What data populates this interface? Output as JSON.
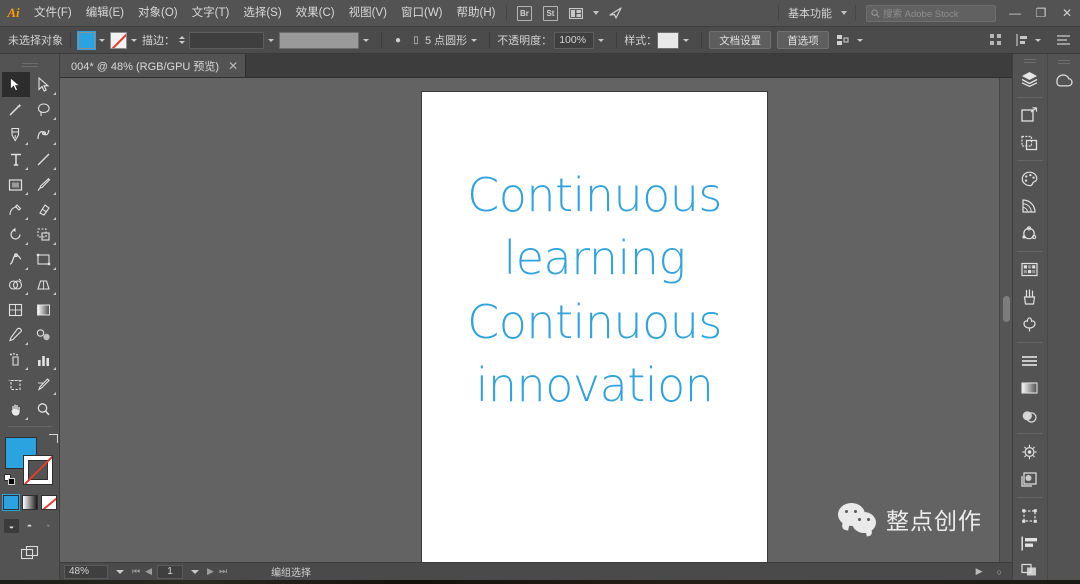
{
  "app": {
    "name": "Adobe Illustrator",
    "logo_text": "Ai",
    "accent_blue": "#2ba3e0",
    "chrome_bg": "#535353",
    "canvas_bg": "#636363"
  },
  "menubar": {
    "items": [
      {
        "label": "文件(F)"
      },
      {
        "label": "编辑(E)"
      },
      {
        "label": "对象(O)"
      },
      {
        "label": "文字(T)"
      },
      {
        "label": "选择(S)"
      },
      {
        "label": "效果(C)"
      },
      {
        "label": "视图(V)"
      },
      {
        "label": "窗口(W)"
      },
      {
        "label": "帮助(H)"
      }
    ],
    "icons": [
      {
        "name": "bridge-icon",
        "glyph": "Br"
      },
      {
        "name": "stock-icon",
        "glyph": "St"
      },
      {
        "name": "arrange-documents-icon",
        "glyph": "▤"
      },
      {
        "name": "mobile-preview-icon",
        "glyph": "✈"
      }
    ],
    "workspace": "基本功能",
    "search_placeholder": "搜索 Adobe Stock",
    "window_buttons": [
      "—",
      "❐",
      "✕"
    ]
  },
  "controlbar": {
    "selection_state": "未选择对象",
    "fill_label": "填色",
    "fill_color": "#2ba3e0",
    "stroke_label": "描边：",
    "stroke_value": "",
    "stroke_weight": "",
    "brush_label": "",
    "variable_width_label": "5 点圆形",
    "opacity_label": "不透明度：",
    "opacity_value": "100%",
    "style_label": "样式：",
    "doc_setup_button": "文档设置",
    "preferences_button": "首选项",
    "align_icon": "align-icon",
    "distribute_icon": "distribute-icon",
    "transform_icon": "transform-icon",
    "menu_icon": "panel-menu-icon"
  },
  "tabs": [
    {
      "title": "004* @ 48% (RGB/GPU 预览)",
      "close": "✕",
      "active": true
    }
  ],
  "toolbar": {
    "tools": [
      {
        "name": "selection-tool",
        "label": "选择工具",
        "active": true
      },
      {
        "name": "direct-selection-tool",
        "label": "直接选择工具",
        "active": false
      },
      {
        "name": "magic-wand-tool",
        "label": "魔棒工具",
        "active": false
      },
      {
        "name": "lasso-tool",
        "label": "套索工具",
        "active": false
      },
      {
        "name": "pen-tool",
        "label": "钢笔工具",
        "active": false
      },
      {
        "name": "curvature-tool",
        "label": "曲率工具",
        "active": false
      },
      {
        "name": "type-tool",
        "label": "文字工具",
        "active": false
      },
      {
        "name": "line-segment-tool",
        "label": "直线段工具",
        "active": false
      },
      {
        "name": "rectangle-tool",
        "label": "矩形工具",
        "active": false
      },
      {
        "name": "paintbrush-tool",
        "label": "画笔工具",
        "active": false
      },
      {
        "name": "pencil-tool",
        "label": "铅笔工具",
        "active": false
      },
      {
        "name": "eraser-tool",
        "label": "橡皮擦工具",
        "active": false
      },
      {
        "name": "rotate-tool",
        "label": "旋转工具",
        "active": false
      },
      {
        "name": "scale-tool",
        "label": "比例缩放工具",
        "active": false
      },
      {
        "name": "width-tool",
        "label": "宽度工具",
        "active": false
      },
      {
        "name": "free-transform-tool",
        "label": "自由变换工具",
        "active": false
      },
      {
        "name": "shape-builder-tool",
        "label": "形状生成器工具",
        "active": false
      },
      {
        "name": "perspective-grid-tool",
        "label": "透视网格工具",
        "active": false
      },
      {
        "name": "mesh-tool",
        "label": "网格工具",
        "active": false
      },
      {
        "name": "gradient-tool",
        "label": "渐变工具",
        "active": false
      },
      {
        "name": "eyedropper-tool",
        "label": "吸管工具",
        "active": false
      },
      {
        "name": "blend-tool",
        "label": "混合工具",
        "active": false
      },
      {
        "name": "symbol-sprayer-tool",
        "label": "符号喷枪工具",
        "active": false
      },
      {
        "name": "column-graph-tool",
        "label": "柱形图工具",
        "active": false
      },
      {
        "name": "artboard-tool",
        "label": "画板工具",
        "active": false
      },
      {
        "name": "slice-tool",
        "label": "切片工具",
        "active": false
      },
      {
        "name": "hand-tool",
        "label": "抓手工具",
        "active": false
      },
      {
        "name": "zoom-tool",
        "label": "缩放工具",
        "active": false
      }
    ],
    "fill_color": "#2ba3e0",
    "stroke_color": "none",
    "color_modes": [
      {
        "name": "color-mode-solid",
        "selected": true
      },
      {
        "name": "color-mode-gradient",
        "selected": false
      },
      {
        "name": "color-mode-none",
        "selected": false
      }
    ],
    "draw_modes": [
      {
        "name": "draw-normal-mode",
        "glyph": "◒",
        "selected": true
      },
      {
        "name": "draw-behind-mode",
        "glyph": "◓",
        "selected": false
      },
      {
        "name": "draw-inside-mode",
        "glyph": "◔",
        "selected": false
      }
    ],
    "screen_mode": {
      "name": "change-screen-mode",
      "glyph": "❐"
    }
  },
  "canvas": {
    "artboard_lines": [
      "Continuous",
      "learning",
      "Continuous",
      "innovation"
    ],
    "text_color": "#2fa3e0",
    "artboard_bg": "#ffffff"
  },
  "watermark": {
    "text": "整点创作",
    "icon": "wechat-icon"
  },
  "statusbar": {
    "zoom": "48%",
    "page": "1",
    "status_text": "编组选择",
    "nav_first": "⏮",
    "nav_prev": "◀",
    "nav_next": "▶",
    "nav_last": "⏭"
  },
  "dock": {
    "column_one": [
      {
        "name": "layers-panel-icon",
        "label": "图层"
      },
      {
        "name": "artboards-panel-icon",
        "label": "画板"
      },
      {
        "name": "asset-export-panel-icon",
        "label": "资源导出"
      },
      {
        "name": "color-panel-icon",
        "label": "颜色"
      },
      {
        "name": "color-guide-panel-icon",
        "label": "颜色参考"
      },
      {
        "name": "recolor-artwork-icon",
        "label": "重新着色图稿"
      },
      {
        "name": "swatches-panel-icon",
        "label": "色板"
      },
      {
        "name": "brushes-panel-icon",
        "label": "画笔"
      },
      {
        "name": "symbols-panel-icon",
        "label": "符号"
      },
      {
        "name": "stroke-panel-icon",
        "label": "描边"
      },
      {
        "name": "gradient-panel-icon",
        "label": "渐变"
      },
      {
        "name": "transparency-panel-icon",
        "label": "透明度"
      },
      {
        "name": "appearance-panel-icon",
        "label": "外观"
      },
      {
        "name": "graphic-styles-panel-icon",
        "label": "图形样式"
      },
      {
        "name": "transform-panel-icon",
        "label": "变换"
      },
      {
        "name": "align-panel-icon",
        "label": "对齐"
      },
      {
        "name": "pathfinder-panel-icon",
        "label": "路径查找器"
      }
    ],
    "column_two": [
      {
        "name": "libraries-panel-icon",
        "label": "库"
      }
    ]
  }
}
